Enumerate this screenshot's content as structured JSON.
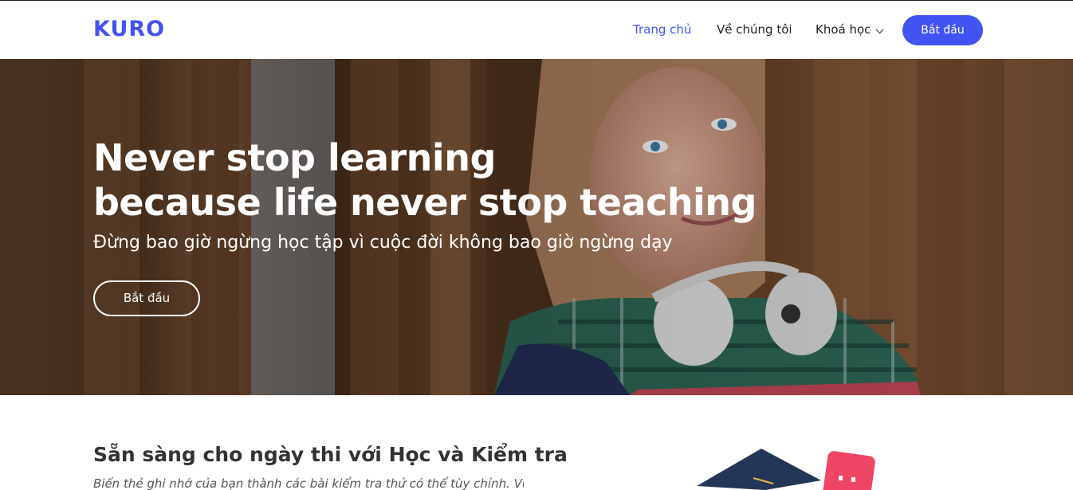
{
  "brand": {
    "name": "KURO",
    "color": "#4154f1"
  },
  "nav": {
    "items": [
      {
        "label": "Trang chủ",
        "active": true
      },
      {
        "label": "Về chúng tôi",
        "active": false
      },
      {
        "label": "Khoá học",
        "active": false,
        "has_dropdown": true,
        "icon": "chevron-down-icon"
      }
    ],
    "cta_label": "Bắt đầu"
  },
  "hero": {
    "title_line1": "Never stop learning",
    "title_line2": "because life never stop teaching",
    "subtitle": "Đừng bao giờ ngừng học tập vì cuộc đời không bao giờ ngừng dạy",
    "button_label": "Bắt đầu"
  },
  "features": {
    "title": "Sẵn sàng cho ngày thi với Học và Kiểm tra",
    "description": "Biến thẻ ghi nhớ của bạn thành các bài kiểm tra thử có thể tùy chỉnh. Vượt"
  }
}
